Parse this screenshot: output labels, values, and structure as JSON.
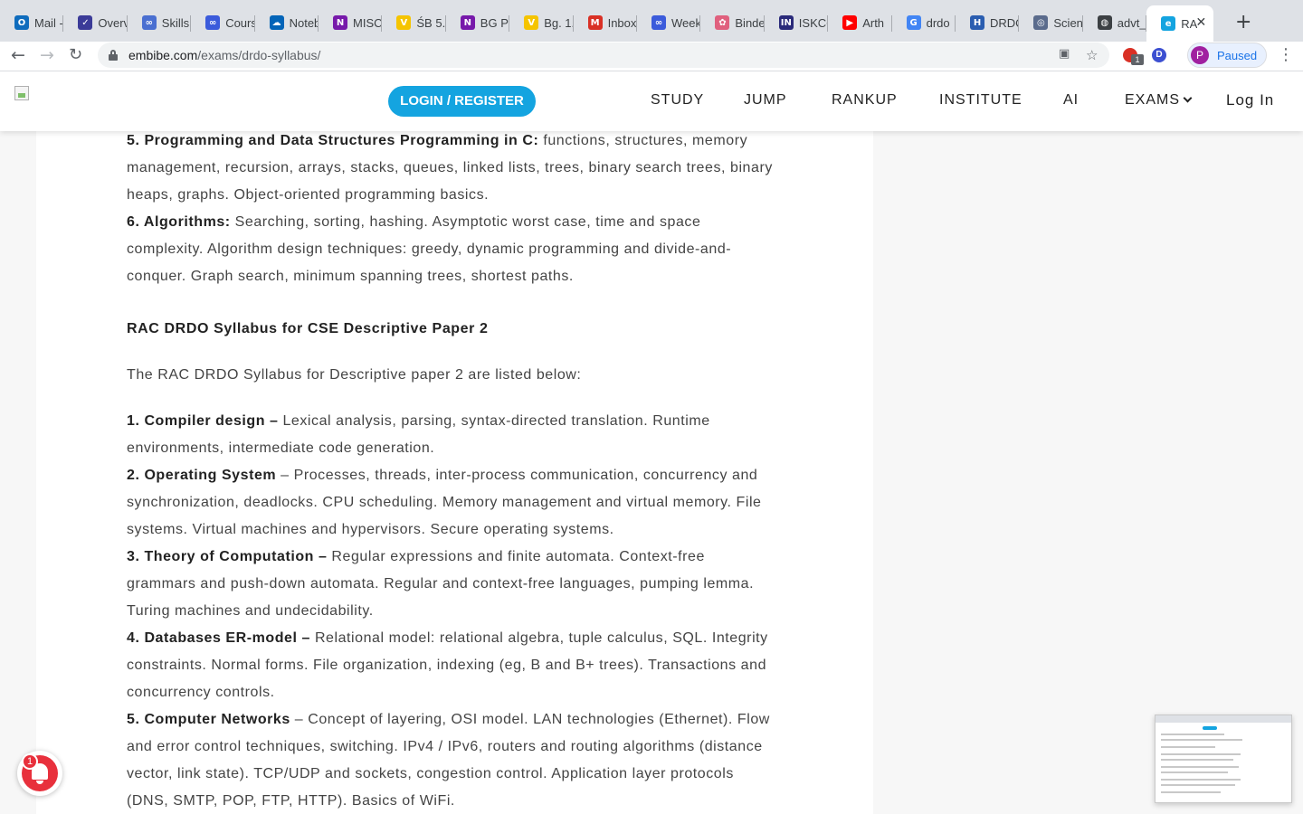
{
  "browser": {
    "tabs": [
      {
        "title": "Mail -",
        "fav_color": "#0f6cbd",
        "fav_glyph": "O"
      },
      {
        "title": "Overv",
        "fav_color": "#3b3b98",
        "fav_glyph": "✓"
      },
      {
        "title": "Skills",
        "fav_color": "#4a6fd1",
        "fav_glyph": "∞"
      },
      {
        "title": "Cours",
        "fav_color": "#3b5bdb",
        "fav_glyph": "∞"
      },
      {
        "title": "Noteb",
        "fav_color": "#0364b8",
        "fav_glyph": "☁"
      },
      {
        "title": "MISC",
        "fav_color": "#7719aa",
        "fav_glyph": "N"
      },
      {
        "title": "ŚB 5.",
        "fav_color": "#f5c400",
        "fav_glyph": "V"
      },
      {
        "title": "BG Pr",
        "fav_color": "#7719aa",
        "fav_glyph": "N"
      },
      {
        "title": "Bg. 1.",
        "fav_color": "#f5c400",
        "fav_glyph": "V"
      },
      {
        "title": "Inbox",
        "fav_color": "#d93025",
        "fav_glyph": "M"
      },
      {
        "title": "Week",
        "fav_color": "#3b5bdb",
        "fav_glyph": "∞"
      },
      {
        "title": "Binde",
        "fav_color": "#e0607e",
        "fav_glyph": "✿"
      },
      {
        "title": "ISKCC",
        "fav_color": "#2a2a7a",
        "fav_glyph": "IN"
      },
      {
        "title": "Arth",
        "fav_color": "#ff0000",
        "fav_glyph": "▶"
      },
      {
        "title": "drdo",
        "fav_color": "#4285f4",
        "fav_glyph": "G"
      },
      {
        "title": "DRDC",
        "fav_color": "#2a5db0",
        "fav_glyph": "H"
      },
      {
        "title": "Scien",
        "fav_color": "#5a6b8c",
        "fav_glyph": "◎"
      },
      {
        "title": "advt_",
        "fav_color": "#3c4043",
        "fav_glyph": "◍"
      },
      {
        "title": "RA",
        "fav_color": "#14a4e0",
        "fav_glyph": "e"
      }
    ],
    "url_host": "embibe.com",
    "url_path": "/exams/drdo-syllabus/",
    "profile_initial": "P",
    "profile_status": "Paused",
    "ext_badge": "1",
    "ext_d": "D"
  },
  "site": {
    "login_register": "LOGIN / REGISTER",
    "nav": [
      "STUDY",
      "JUMP",
      "RANKUP",
      "INSTITUTE",
      "AI",
      "EXAMS"
    ],
    "login": "Log In"
  },
  "content": {
    "p1_label": "5. Programming and Data Structures Programming in C:",
    "p1_text": " functions, structures, memory management, recursion, arrays, stacks, queues, linked lists, trees, binary search trees, binary heaps, graphs.  Object-oriented programming basics.",
    "p2_label": "6. Algorithms:",
    "p2_text": " Searching, sorting, hashing. Asymptotic worst case, time and space complexity. Algorithm design techniques: greedy, dynamic programming and divide-and-conquer. Graph search, minimum spanning trees, shortest paths.",
    "heading": "RAC DRDO Syllabus for CSE Descriptive Paper 2",
    "intro": "The RAC DRDO Syllabus for Descriptive paper 2 are listed below:",
    "i1_label": "1. Compiler design –",
    "i1_text": "  Lexical analysis, parsing, syntax-directed translation. Runtime environments, intermediate code generation.",
    "i2_label": "2. Operating System",
    "i2_text": " – Processes, threads, inter-process communication, concurrency and synchronization, deadlocks. CPU scheduling. Memory management and virtual memory. File systems. Virtual machines and hypervisors. Secure operating systems.",
    "i3_label": "3. Theory of Computation –",
    "i3_text": "  Regular expressions and finite automata. Context-free grammars and push-down automata. Regular and context-free languages, pumping lemma.  Turing machines and undecidability.",
    "i4_label": "4. Databases ER-model –",
    "i4_text": " Relational model: relational algebra, tuple calculus, SQL.  Integrity constraints. Normal forms. File organization, indexing (eg, B and B+ trees).  Transactions and concurrency controls.",
    "i5_label": "5. Computer Networks",
    "i5_text": " – Concept of layering, OSI model. LAN technologies (Ethernet). Flow and error control techniques, switching.  IPv4 / IPv6, routers and routing algorithms (distance vector, link state).  TCP/UDP and sockets, congestion control. Application layer protocols (DNS, SMTP, POP, FTP, HTTP).  Basics of WiFi."
  },
  "notification": {
    "count": "1"
  }
}
